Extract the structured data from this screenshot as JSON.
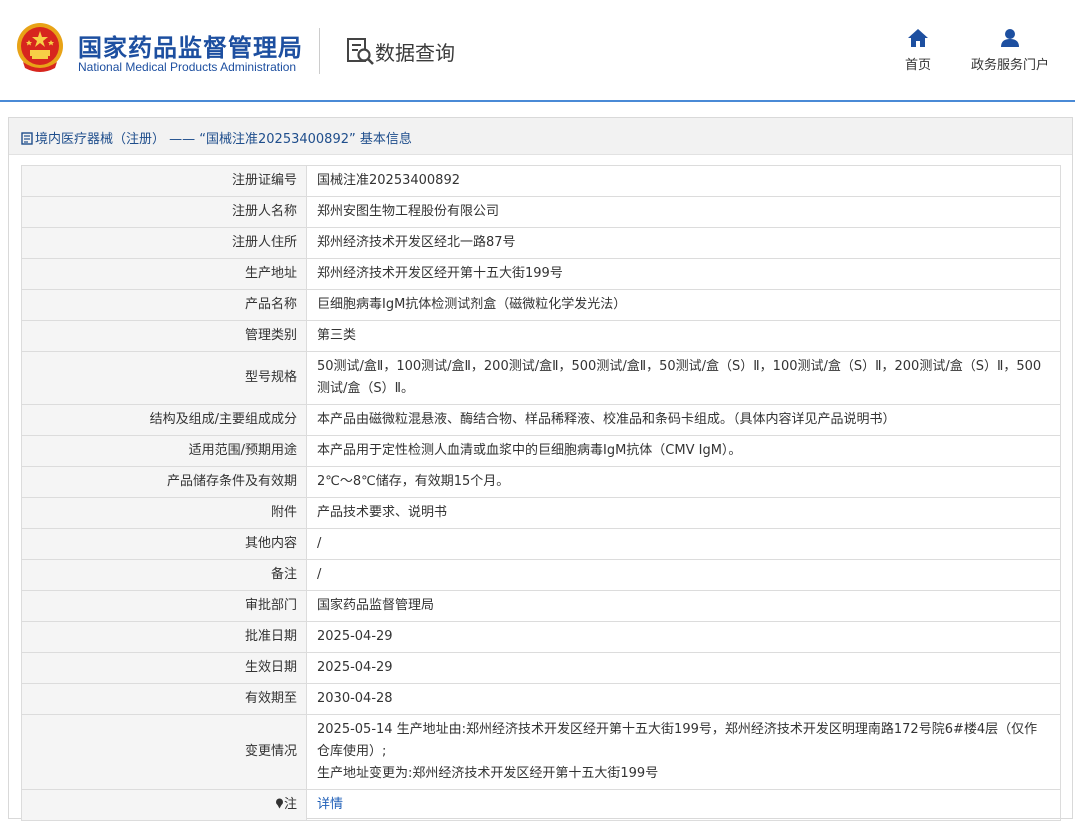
{
  "header": {
    "agency_name_cn": "国家药品监督管理局",
    "agency_name_en": "National Medical Products Administration",
    "query_title": "数据查询",
    "nav": [
      {
        "label": "首页",
        "icon": "home-icon"
      },
      {
        "label": "政务服务门户",
        "icon": "user-icon"
      }
    ],
    "accent_color": "#1d4fa0"
  },
  "breadcrumb": {
    "text": "境内医疗器械（注册） —— “国械注准20253400892” 基本信息",
    "icon": "document-icon"
  },
  "record": {
    "rows": [
      {
        "label": "注册证编号",
        "value": "国械注准20253400892"
      },
      {
        "label": "注册人名称",
        "value": "郑州安图生物工程股份有限公司"
      },
      {
        "label": "注册人住所",
        "value": "郑州经济技术开发区经北一路87号"
      },
      {
        "label": "生产地址",
        "value": "郑州经济技术开发区经开第十五大街199号"
      },
      {
        "label": "产品名称",
        "value": "巨细胞病毒IgM抗体检测试剂盒（磁微粒化学发光法）"
      },
      {
        "label": "管理类别",
        "value": "第三类"
      },
      {
        "label": "型号规格",
        "value": "50测试/盒Ⅱ，100测试/盒Ⅱ，200测试/盒Ⅱ，500测试/盒Ⅱ，50测试/盒（S）Ⅱ，100测试/盒（S）Ⅱ，200测试/盒（S）Ⅱ，500测试/盒（S）Ⅱ。"
      },
      {
        "label": "结构及组成/主要组成成分",
        "value": "本产品由磁微粒混悬液、酶结合物、样品稀释液、校准品和条码卡组成。（具体内容详见产品说明书）"
      },
      {
        "label": "适用范围/预期用途",
        "value": "本产品用于定性检测人血清或血浆中的巨细胞病毒IgM抗体（CMV IgM）。"
      },
      {
        "label": "产品储存条件及有效期",
        "value": "2℃～8℃储存，有效期15个月。"
      },
      {
        "label": "附件",
        "value": "产品技术要求、说明书"
      },
      {
        "label": "其他内容",
        "value": "/"
      },
      {
        "label": "备注",
        "value": "/"
      },
      {
        "label": "审批部门",
        "value": "国家药品监督管理局"
      },
      {
        "label": "批准日期",
        "value": "2025-04-29"
      },
      {
        "label": "生效日期",
        "value": "2025-04-29"
      },
      {
        "label": "有效期至",
        "value": "2030-04-28"
      },
      {
        "label": "变更情况",
        "value_lines": [
          "2025-05-14 生产地址由:郑州经济技术开发区经开第十五大街199号，郑州经济技术开发区明理南路172号院6#楼4层（仅作仓库使用）;",
          "生产地址变更为:郑州经济技术开发区经开第十五大街199号"
        ]
      },
      {
        "label": "注",
        "label_icon": "pin-icon",
        "link": "详情"
      }
    ]
  }
}
